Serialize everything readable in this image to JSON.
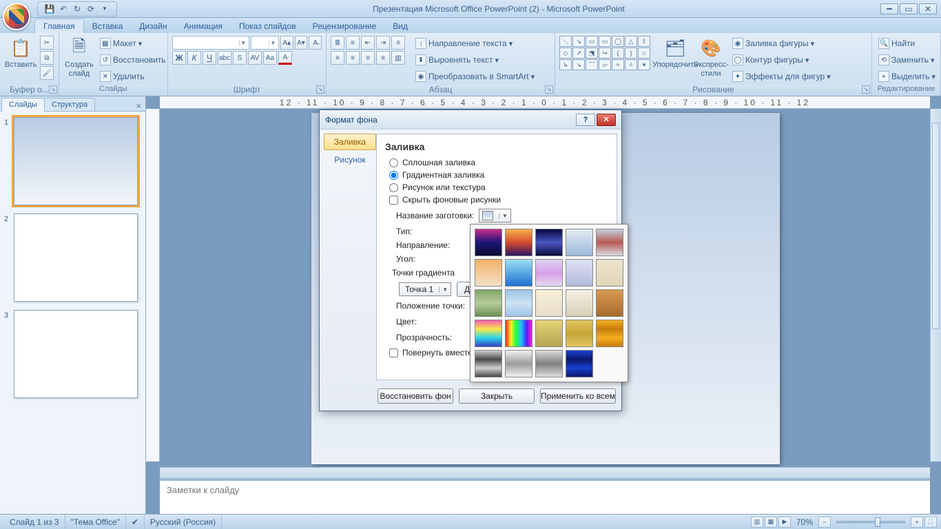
{
  "title": "Презентация Microsoft Office PowerPoint (2) - Microsoft PowerPoint",
  "tabs": {
    "home": "Главная",
    "insert": "Вставка",
    "design": "Дизайн",
    "animation": "Анимация",
    "slideshow": "Показ слайдов",
    "review": "Рецензирование",
    "view": "Вид"
  },
  "groups": {
    "clipboard": "Буфер о...",
    "slides": "Слайды",
    "font": "Шрифт",
    "paragraph": "Абзац",
    "drawing": "Рисование",
    "editing": "Редактирование"
  },
  "buttons": {
    "paste": "Вставить",
    "new_slide": "Создать\nслайд",
    "layout": "Макет",
    "reset": "Восстановить",
    "delete": "Удалить",
    "arrange": "Упорядочить",
    "quick_styles": "Экспресс-стили",
    "shape_fill": "Заливка фигуры",
    "shape_outline": "Контур фигуры",
    "shape_effects": "Эффекты для фигур",
    "find": "Найти",
    "replace": "Заменить",
    "select": "Выделить",
    "text_direction": "Направление текста",
    "align_text": "Выровнять текст",
    "smartart": "Преобразовать в SmartArt"
  },
  "panel": {
    "slides_tab": "Слайды",
    "outline_tab": "Структура"
  },
  "slide_nums": [
    "1",
    "2",
    "3"
  ],
  "ruler_numbers": "12 · 11 · 10 · 9 · 8 · 7 · 6 · 5 · 4 · 3 · 2 · 1 · 0 · 1 · 2 · 3 · 4 · 5 · 6 · 7 · 8 · 9 · 10 · 11 · 12",
  "notes_placeholder": "Заметки к слайду",
  "status": {
    "slide": "Слайд 1 из 3",
    "theme": "\"Тема Office\"",
    "lang": "Русский (Россия)",
    "zoom": "70%"
  },
  "dialog": {
    "title": "Формат фона",
    "side_fill": "Заливка",
    "side_picture": "Рисунок",
    "section": "Заливка",
    "opt_solid": "Сплошная заливка",
    "opt_gradient": "Градиентная заливка",
    "opt_picture": "Рисунок или текстура",
    "opt_hide": "Скрыть фоновые рисунки",
    "preset_label": "Название заготовки:",
    "type_label": "Тип:",
    "direction_label": "Направление:",
    "angle_label": "Угол:",
    "stops_label": "Точки градиента",
    "stop1": "Точка 1",
    "add": "Д",
    "pos_label": "Положение точки:",
    "color_label": "Цвет:",
    "transparency_label": "Прозрачность:",
    "rotate": "Повернуть вместе с фигурой",
    "btn_restore": "Восстановить фон",
    "btn_close": "Закрыть",
    "btn_apply": "Применить ко всем"
  },
  "preset_gradients": [
    "linear-gradient(#c62b8b,#1a1676,#0b0b30)",
    "linear-gradient(#f5b24b,#d44a2b,#2b1766)",
    "linear-gradient(#02063b,#4a57c2,#0a0a3b)",
    "linear-gradient(#e4ecf6,#9bb8da)",
    "linear-gradient(#c3cfe0,#b85c54,#d8dbe2)",
    "linear-gradient(#f2b26a,#f4e0c6)",
    "linear-gradient(#9be0f5,#1b6fd4)",
    "linear-gradient(#e0d3f3,#d79fe6,#e6d9f3)",
    "linear-gradient(#dfe2f3,#b4b9df)",
    "linear-gradient(#ebe3cd,#e0d6b8)",
    "linear-gradient(#7fa565,#b6cc99,#6d9050)",
    "linear-gradient(#9fc3e6,#cde3f6,#9fc3e6)",
    "linear-gradient(#f6eed5,#e9decb)",
    "linear-gradient(#f5f0e5,#d9cfb8)",
    "linear-gradient(#d89a52,#a86b2d)",
    "linear-gradient(#f55bb0,#fae84b,#2bd6e8,#3340c7)",
    "linear-gradient(90deg,#ff2020,#ffef20,#20ff40,#20bfff,#5020ff,#ff20d0)",
    "linear-gradient(#e6d47a,#cdbb64,#b8a552)",
    "linear-gradient(#e0c560,#c5a637,#e0c560)",
    "linear-gradient(#f5b020,#c77c0c,#f5b020,#c77c0c)",
    "linear-gradient(#cfcfcf,#4a4a4a,#cfcfcf,#4a4a4a)",
    "linear-gradient(#f2f2f2,#9c9c9c,#f2f2f2)",
    "linear-gradient(#dcdcdc,#7f7f7f,#dcdcdc)",
    "linear-gradient(#1a3fd0,#0a1a6b,#1a3fd0,#0a1a6b)"
  ]
}
